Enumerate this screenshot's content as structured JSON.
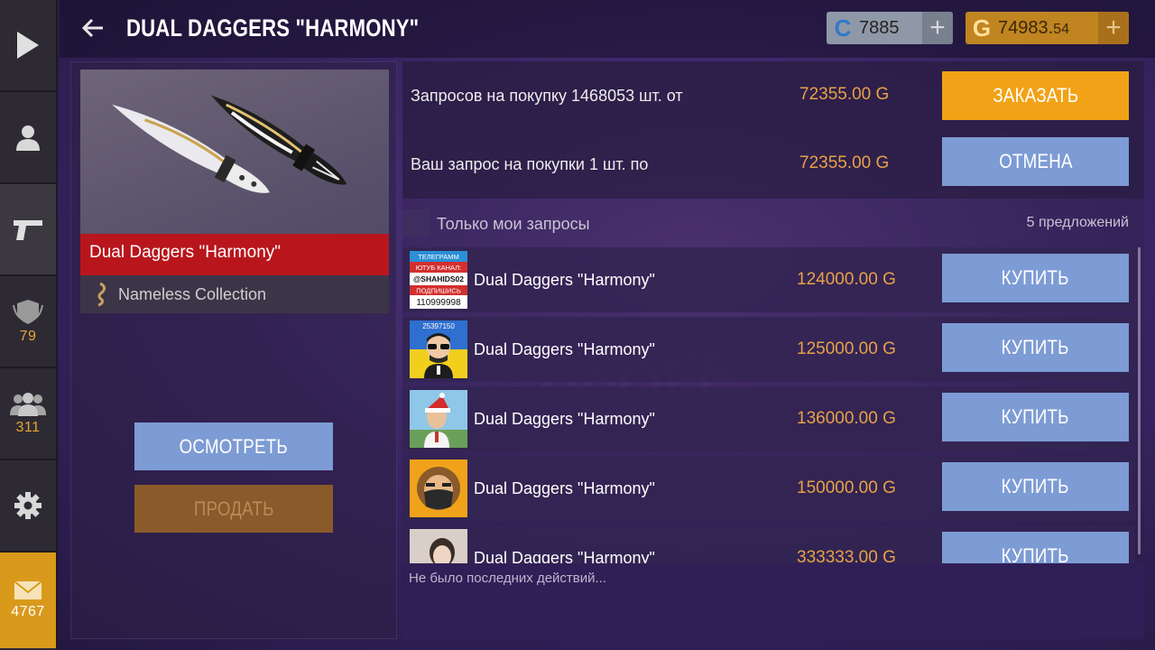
{
  "nav": {
    "items": [
      {
        "name": "play",
        "icon": "play-icon"
      },
      {
        "name": "profile",
        "icon": "person-icon"
      },
      {
        "name": "inventory",
        "icon": "pistol-icon"
      },
      {
        "name": "rank",
        "icon": "shield-icon",
        "count": "79"
      },
      {
        "name": "friends",
        "icon": "people-icon",
        "count": "311"
      },
      {
        "name": "settings",
        "icon": "gear-icon"
      },
      {
        "name": "mail",
        "icon": "mail-icon",
        "count": "4767"
      }
    ]
  },
  "header": {
    "title": "DUAL DAGGERS \"HARMONY\"",
    "credits": {
      "symbol": "C",
      "value": "7885"
    },
    "gold": {
      "symbol": "G",
      "value_main": "74983.",
      "value_frac": "54"
    }
  },
  "item": {
    "name": "Dual Daggers \"Harmony\"",
    "collection": "Nameless Collection",
    "inspect_label": "ОСМОТРЕТЬ",
    "sell_label": "ПРОДАТЬ"
  },
  "requests": {
    "summary_label": "Запросов на покупку 1468053 шт. от",
    "summary_price": "72355.00 G",
    "order_label": "ЗАКАЗАТЬ",
    "own_label": "Ваш запрос на покупки 1 шт.  по",
    "own_price": "72355.00 G",
    "cancel_label": "ОТМЕНА"
  },
  "filter": {
    "only_mine_label": "Только мои запросы",
    "offers_count": "5 предложений"
  },
  "offers": [
    {
      "name": "Dual Daggers \"Harmony\"",
      "price": "124000.00 G",
      "buy_label": "КУПИТЬ",
      "avatar": "telegram-banner-avatar"
    },
    {
      "name": "Dual Daggers \"Harmony\"",
      "price": "125000.00 G",
      "buy_label": "КУПИТЬ",
      "avatar": "sunglasses-avatar"
    },
    {
      "name": "Dual Daggers \"Harmony\"",
      "price": "136000.00 G",
      "buy_label": "КУПИТЬ",
      "avatar": "santa-hat-avatar"
    },
    {
      "name": "Dual Daggers \"Harmony\"",
      "price": "150000.00 G",
      "buy_label": "КУПИТЬ",
      "avatar": "masked-avatar"
    },
    {
      "name": "Dual Daggers \"Harmony\"",
      "price": "333333.00 G",
      "buy_label": "КУПИТЬ",
      "avatar": "photo-avatar"
    }
  ],
  "avatar_text": {
    "banner_line1": "ТЕЛЕГРАММ",
    "banner_line2": "ЮТУБ КАНАЛ:",
    "banner_line3": "@SHAHIDS02",
    "banner_line4": "ПОДПИШИСЬ",
    "banner_line5": "110999998",
    "id_line": "25397150"
  },
  "log": {
    "text": "Не было последних действий..."
  },
  "colors": {
    "gold": "#e7a147",
    "accent_orange": "#f2a216",
    "button_blue": "#7d9bd4",
    "rarity_red": "#b8161c"
  }
}
